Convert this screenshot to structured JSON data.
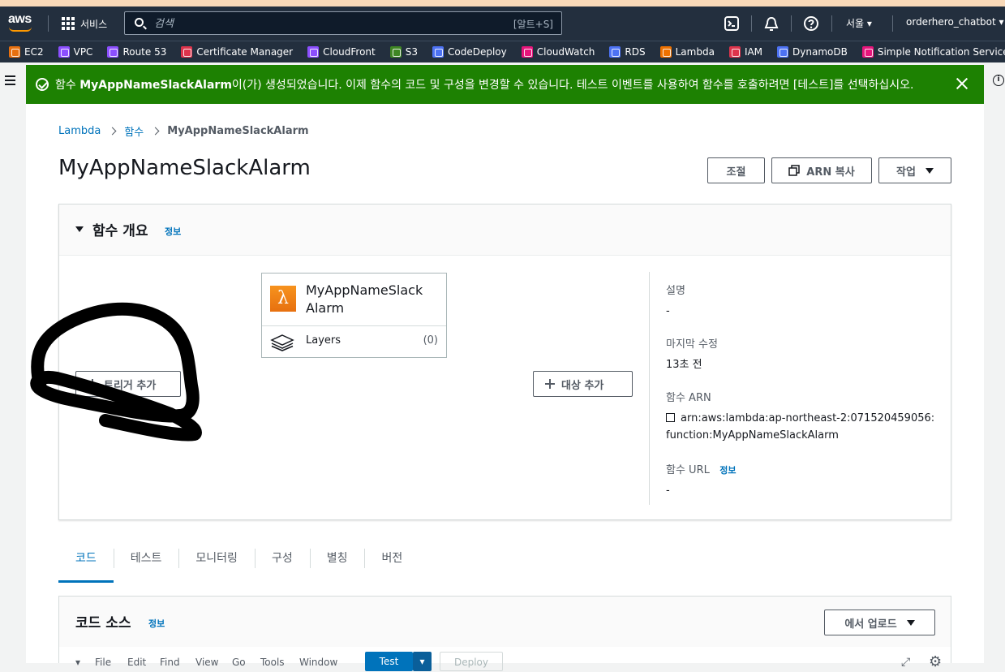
{
  "navbar": {
    "logo": "aws",
    "services_label": "서비스",
    "search_placeholder": "검색",
    "search_shortcut": "[알트+S]",
    "region": "서울 ▾",
    "account": "orderhero_chatbot ▾"
  },
  "bookmarks": [
    {
      "label": "EC2",
      "color": "#e7700f"
    },
    {
      "label": "VPC",
      "color": "#8c4fff"
    },
    {
      "label": "Route 53",
      "color": "#8c4fff"
    },
    {
      "label": "Certificate Manager",
      "color": "#dd344c"
    },
    {
      "label": "CloudFront",
      "color": "#8c4fff"
    },
    {
      "label": "S3",
      "color": "#3f8624"
    },
    {
      "label": "CodeDeploy",
      "color": "#4d72f3"
    },
    {
      "label": "CloudWatch",
      "color": "#e7157b"
    },
    {
      "label": "RDS",
      "color": "#4d72f3"
    },
    {
      "label": "Lambda",
      "color": "#ed7100"
    },
    {
      "label": "IAM",
      "color": "#dd344c"
    },
    {
      "label": "DynamoDB",
      "color": "#4d72f3"
    },
    {
      "label": "Simple Notification Service",
      "color": "#e7157b"
    }
  ],
  "flash": {
    "prefix": "함수 ",
    "function_name": "MyAppNameSlackAlarm",
    "suffix": "이(가) 생성되었습니다. 이제 함수의 코드 및 구성을 변경할 수 있습니다. 테스트 이벤트를 사용하여 함수를 호출하려면 [테스트]를 선택하십시오."
  },
  "breadcrumb": {
    "root": "Lambda",
    "mid": "함수",
    "current": "MyAppNameSlackAlarm"
  },
  "page": {
    "title": "MyAppNameSlackAlarm",
    "btn_throttle": "조절",
    "btn_copy_arn": "ARN 복사",
    "btn_actions": "작업"
  },
  "overview": {
    "title": "함수 개요",
    "info": "정보",
    "function_name_line1": "MyAppNameSlack",
    "function_name_line2": "Alarm",
    "layers_label": "Layers",
    "layers_count": "(0)",
    "add_trigger": "트리거 추가",
    "add_destination": "대상 추가",
    "desc_label": "설명",
    "desc_value": "-",
    "modified_label": "마지막 수정",
    "modified_value": "13초 전",
    "arn_label": "함수 ARN",
    "arn_line1": "arn:aws:lambda:ap-northeast-2:071520459056:",
    "arn_line2": "function:MyAppNameSlackAlarm",
    "url_label": "함수 URL",
    "url_info": "정보",
    "url_value": "-"
  },
  "tabs": [
    "코드",
    "테스트",
    "모니터링",
    "구성",
    "별칭",
    "버전"
  ],
  "code_source": {
    "title": "코드 소스",
    "info": "정보",
    "upload_button": "에서 업로드",
    "menu": [
      "File",
      "Edit",
      "Find",
      "View",
      "Go",
      "Tools",
      "Window"
    ],
    "test_button": "Test",
    "deploy_button": "Deploy"
  },
  "colors": {
    "nav": "#232f3e",
    "flash": "#1d8102",
    "link": "#0073bb",
    "accent": "#ff9900"
  }
}
